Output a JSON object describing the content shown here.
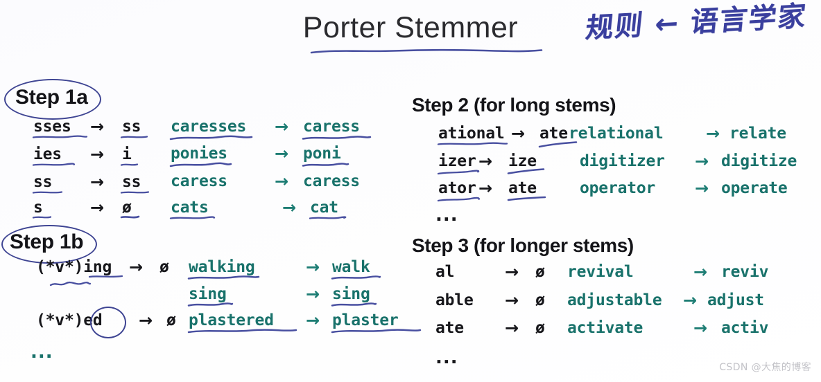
{
  "slide": {
    "title": "Porter Stemmer",
    "handwritten_note": "规则 ← 语言学家",
    "watermark": "CSDN @大焦的博客",
    "colors": {
      "background": "#fbfbfe",
      "ink_black": "#17171b",
      "teal": "#19726b",
      "pen_blue": "#484fa0"
    }
  },
  "sections": {
    "step1a": {
      "heading": "Step 1a",
      "rules": [
        {
          "pattern": "sses",
          "arrow": "→",
          "result": "ss"
        },
        {
          "pattern": "ies",
          "arrow": "→",
          "result": "i"
        },
        {
          "pattern": "ss",
          "arrow": "→",
          "result": "ss"
        },
        {
          "pattern": "s",
          "arrow": "→",
          "result": "ø"
        }
      ],
      "examples": [
        {
          "word": "caresses",
          "arrow": "→",
          "stem": "caress"
        },
        {
          "word": "ponies",
          "arrow": "→",
          "stem": "poni"
        },
        {
          "word": "caress",
          "arrow": "→",
          "stem": "caress"
        },
        {
          "word": "cats",
          "arrow": "→",
          "stem": "cat"
        }
      ]
    },
    "step1b": {
      "heading": "Step 1b",
      "rules": [
        {
          "pattern": "(*v*)ing",
          "arrow": "→",
          "result": "ø"
        },
        {
          "pattern": "(*v*)ed",
          "arrow": "→",
          "result": "ø"
        }
      ],
      "examples": [
        {
          "word": "walking",
          "arrow": "→",
          "stem": "walk"
        },
        {
          "word": "sing",
          "arrow": "→",
          "stem": "sing"
        },
        {
          "word": "plastered",
          "arrow": "→",
          "stem": "plaster"
        }
      ],
      "ellipsis": "..."
    },
    "step2": {
      "heading": "Step 2 (for long stems)",
      "rules": [
        {
          "pattern": "ational",
          "arrow": "→",
          "result": "ate"
        },
        {
          "pattern": "izer",
          "arrow": "→",
          "result": "ize"
        },
        {
          "pattern": "ator",
          "arrow": "→",
          "result": "ate"
        }
      ],
      "examples": [
        {
          "word": "relational",
          "arrow": "→",
          "stem": "relate"
        },
        {
          "word": "digitizer",
          "arrow": "→",
          "stem": "digitize"
        },
        {
          "word": "operator",
          "arrow": "→",
          "stem": "operate"
        }
      ],
      "ellipsis": "..."
    },
    "step3": {
      "heading": "Step 3 (for longer stems)",
      "rules": [
        {
          "pattern": "al",
          "arrow": "→",
          "result": "ø"
        },
        {
          "pattern": "able",
          "arrow": "→",
          "result": "ø"
        },
        {
          "pattern": "ate",
          "arrow": "→",
          "result": "ø"
        }
      ],
      "examples": [
        {
          "word": "revival",
          "arrow": "→",
          "stem": "reviv"
        },
        {
          "word": "adjustable",
          "arrow": "→",
          "stem": "adjust"
        },
        {
          "word": "activate",
          "arrow": "→",
          "stem": "activ"
        }
      ],
      "ellipsis": "..."
    }
  }
}
